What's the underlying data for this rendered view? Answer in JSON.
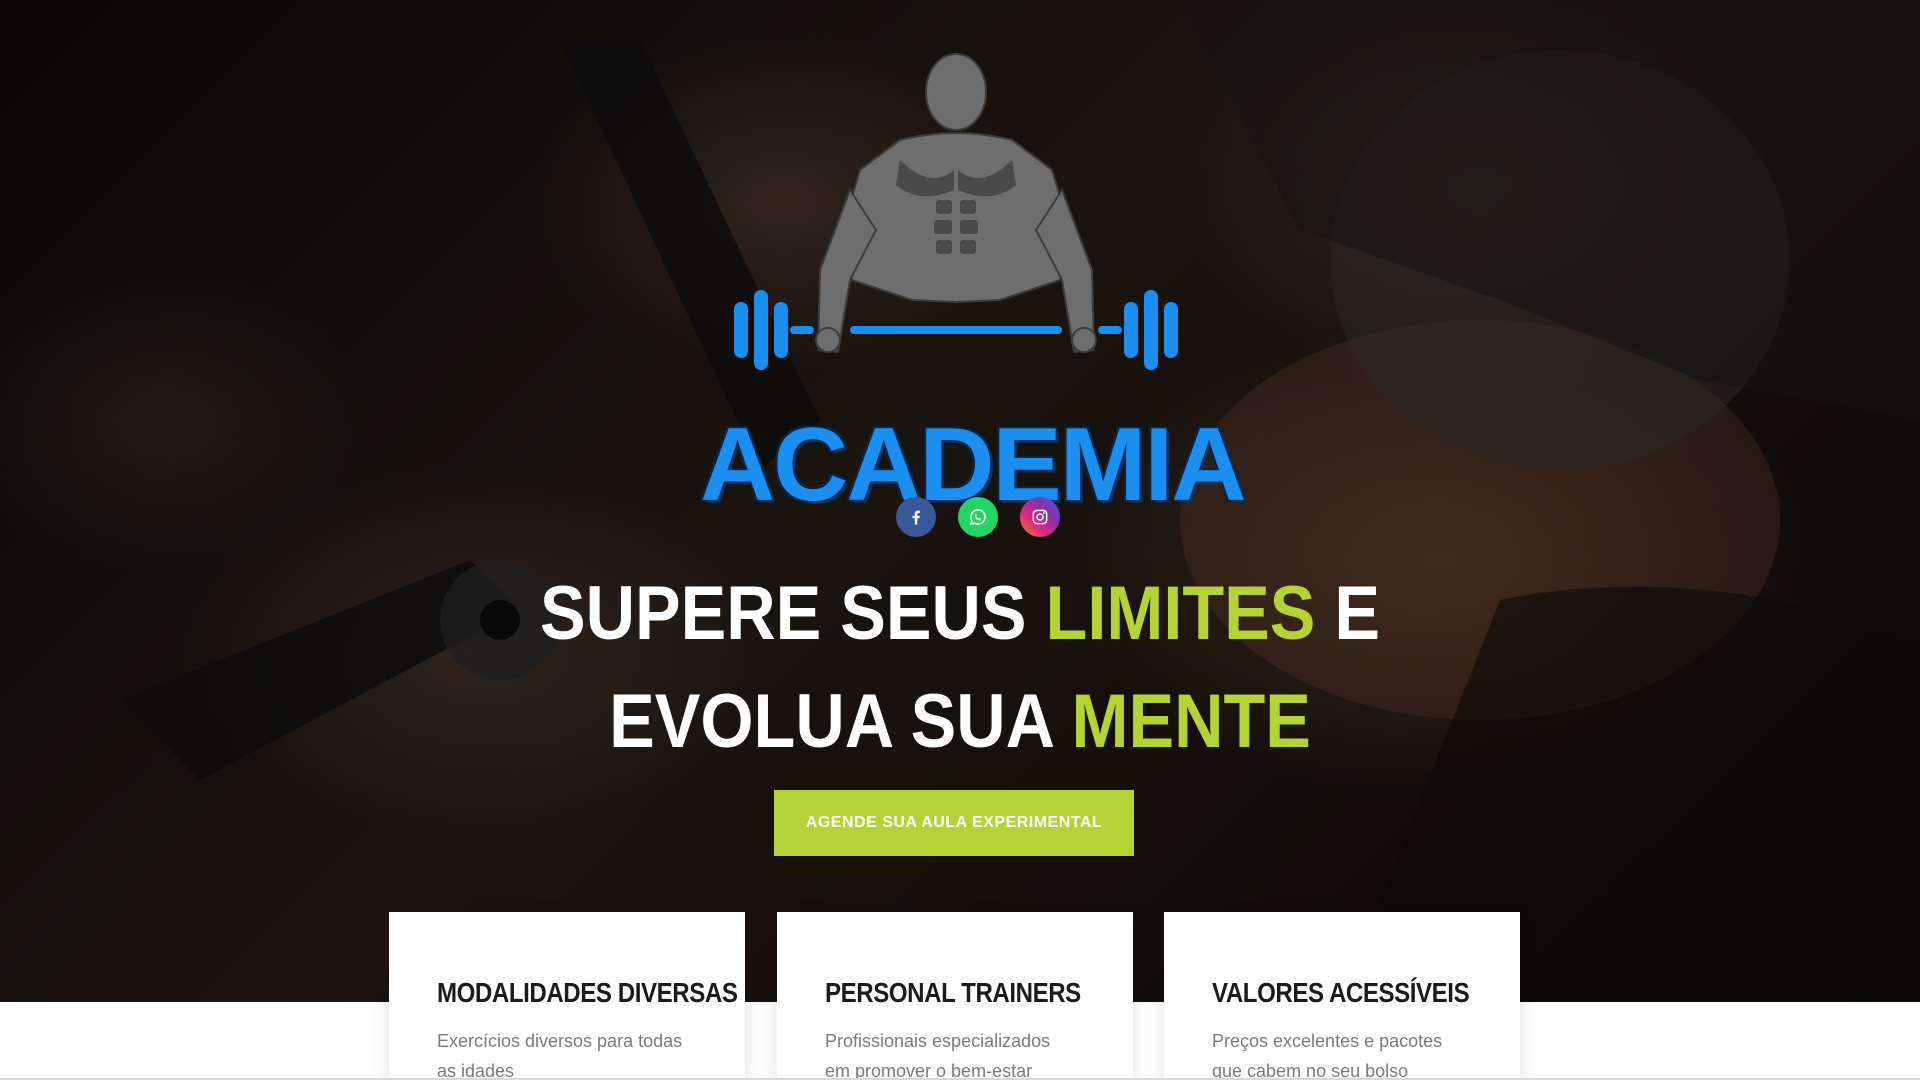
{
  "brand": {
    "name": "ACADEMIA",
    "logo_icon": "bodybuilder-barbell-icon",
    "primary_color": "#1b8ff0"
  },
  "social": [
    {
      "name": "facebook",
      "icon": "facebook-icon",
      "color": "#3b5998"
    },
    {
      "name": "whatsapp",
      "icon": "whatsapp-icon",
      "color": "#25d366"
    },
    {
      "name": "instagram",
      "icon": "instagram-icon",
      "color": "#dd2a7b"
    }
  ],
  "hero": {
    "line1_part1": "SUPERE SEUS ",
    "line1_accent": "LIMITES",
    "line1_part2": " E",
    "line2_part1": "EVOLUA SUA ",
    "line2_accent": "MENTE",
    "accent_color": "#b5d335",
    "cta_label": "AGENDE SUA AULA EXPERIMENTAL"
  },
  "features": [
    {
      "title": "MODALIDADES DIVERSAS",
      "text": "Exercícios diversos para todas as idades"
    },
    {
      "title": "PERSONAL TRAINERS",
      "text": "Profissionais especializados em promover o bem-estar"
    },
    {
      "title": "VALORES ACESSÍVEIS",
      "text": "Preços excelentes e pacotes que cabem no seu bolso"
    }
  ]
}
